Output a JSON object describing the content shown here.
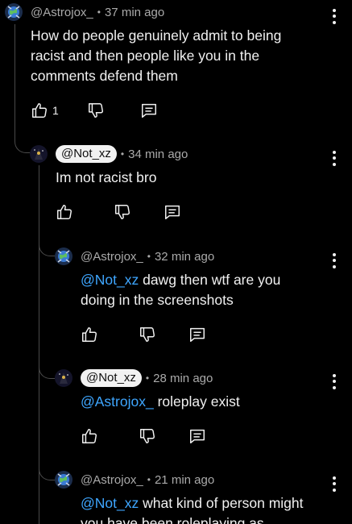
{
  "comments": [
    {
      "username": "@Astrojox_",
      "separator": "•",
      "time": "37 min ago",
      "text": "How do people genuinely admit to being racist and then people like you in the comments defend them",
      "likes": "1"
    },
    {
      "username": "@Not_xz",
      "separator": "•",
      "time": "34 min ago",
      "text": "Im not racist bro"
    },
    {
      "username": "@Astrojox_",
      "separator": "•",
      "time": "32 min ago",
      "mention": "@Not_xz",
      "text": " dawg then wtf are you doing in the screenshots"
    },
    {
      "username": "@Not_xz",
      "separator": "•",
      "time": "28 min ago",
      "mention": "@Astrojox_",
      "text": " roleplay exist"
    },
    {
      "username": "@Astrojox_",
      "separator": "•",
      "time": "21 min ago",
      "mention": "@Not_xz",
      "text": " what kind of person might you have been roleplaying as"
    }
  ],
  "icons": {
    "like": "thumbs-up-icon",
    "dislike": "thumbs-down-icon",
    "reply": "reply-icon",
    "more": "more-vertical-icon"
  },
  "colors": {
    "background": "#000000",
    "mention": "#3ea6ff",
    "meta": "#aaaaaa",
    "text": "#f1f1f1",
    "pill": "#f2f2f2"
  }
}
